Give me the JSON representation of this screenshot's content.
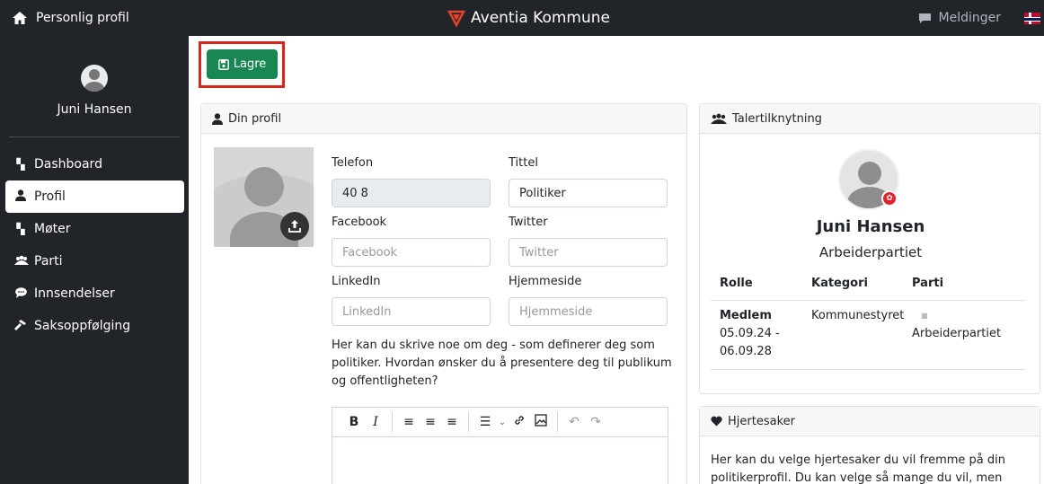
{
  "topbar": {
    "left_label": "Personlig profil",
    "center_title": "Aventia Kommune",
    "messages_label": "Meldinger",
    "icons": [
      "home-icon",
      "aventia-logo-icon",
      "chat-icon",
      "norway-flag-icon"
    ]
  },
  "sidebar": {
    "user_name": "Juni Hansen",
    "items": [
      {
        "label": "Dashboard",
        "icon": "dashboard-icon",
        "active": false
      },
      {
        "label": "Profil",
        "icon": "user-icon",
        "active": true
      },
      {
        "label": "Møter",
        "icon": "meetings-icon",
        "active": false
      },
      {
        "label": "Parti",
        "icon": "party-icon",
        "active": false
      },
      {
        "label": "Innsendelser",
        "icon": "comment-icon",
        "active": false
      },
      {
        "label": "Saksoppfølging",
        "icon": "hammer-icon",
        "active": false
      }
    ]
  },
  "actions": {
    "save_label": "Lagre"
  },
  "profile_card": {
    "header": "Din profil",
    "fields": {
      "telefon": {
        "label": "Telefon",
        "value": "40 8"
      },
      "tittel": {
        "label": "Tittel",
        "value": "Politiker"
      },
      "facebook": {
        "label": "Facebook",
        "placeholder": "Facebook"
      },
      "twitter": {
        "label": "Twitter",
        "placeholder": "Twitter"
      },
      "linkedin": {
        "label": "LinkedIn",
        "placeholder": "LinkedIn"
      },
      "hjemmeside": {
        "label": "Hjemmeside",
        "placeholder": "Hjemmeside"
      }
    },
    "help_text": "Her kan du skrive noe om deg - som definerer deg som politiker. Hvordan ønsker du å presentere deg til publikum og offentligheten?",
    "toolbar": [
      "B",
      "I",
      "≡",
      "≡",
      "≡",
      "☰",
      "⌄",
      "🔗",
      "▣",
      "↶",
      "↷"
    ]
  },
  "taler_card": {
    "header": "Talertilknytning",
    "name": "Juni Hansen",
    "party": "Arbeiderpartiet",
    "columns": [
      "Rolle",
      "Kategori",
      "Parti"
    ],
    "rows": [
      {
        "rolle": "Medlem",
        "periode": "05.09.24 - 06.09.28",
        "kategori": "Kommunestyret",
        "parti": "Arbeiderpartiet"
      }
    ]
  },
  "hjertesaker_card": {
    "header": "Hjertesaker",
    "text": "Her kan du velge hjertesaker du vil fremme på din politikerprofil. Du kan velge så mange du vil, men noen"
  },
  "colors": {
    "topbar": "#212529",
    "save_button": "#198754",
    "highlight": "#d9261c",
    "party_red": "#e4202e"
  }
}
